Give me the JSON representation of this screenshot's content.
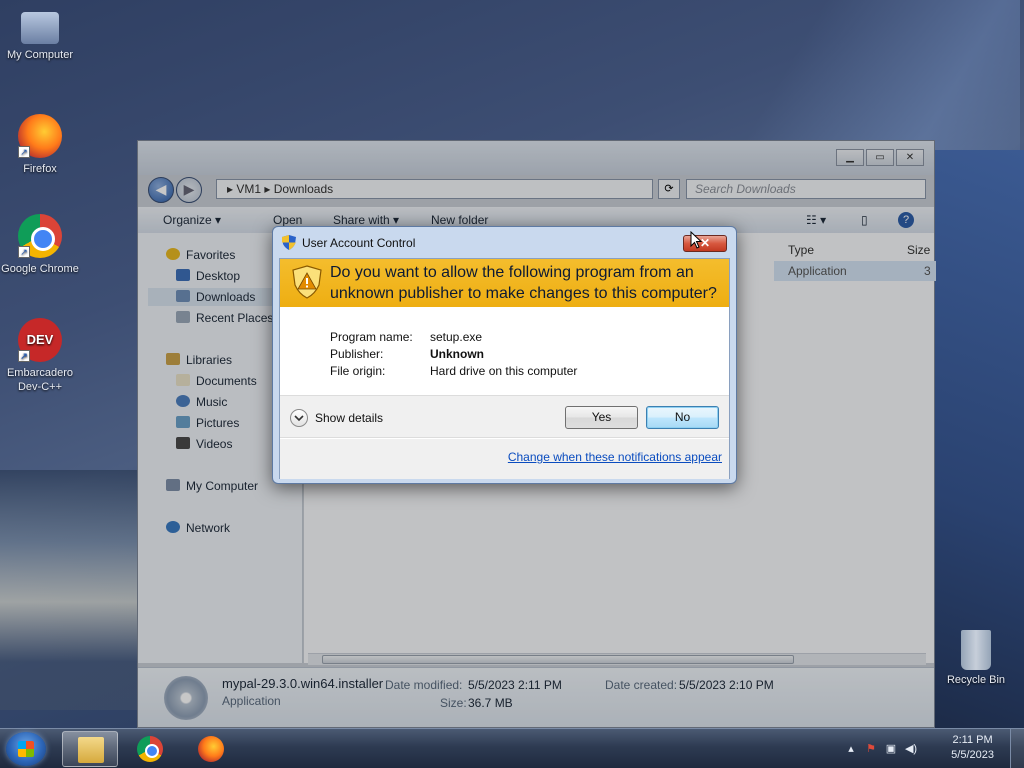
{
  "desktop": {
    "icons": [
      {
        "label": "My Computer"
      },
      {
        "label": "Firefox"
      },
      {
        "label": "Google Chrome"
      },
      {
        "label": "Embarcadero Dev-C++",
        "glyph_text": "DEV"
      }
    ],
    "recycle_bin": {
      "label": "Recycle Bin"
    }
  },
  "explorer": {
    "path": [
      "VM1",
      "Downloads"
    ],
    "search_placeholder": "Search Downloads",
    "toolbar": {
      "organize": "Organize ▾",
      "open": "Open",
      "share_with": "Share with ▾",
      "new_folder": "New folder"
    },
    "columns": {
      "type": "Type",
      "size": "Size"
    },
    "file_type_cell": "Application",
    "file_size_cell": "3",
    "nav": {
      "favorites": "Favorites",
      "desktop": "Desktop",
      "downloads": "Downloads",
      "recent_places": "Recent Places",
      "libraries": "Libraries",
      "documents": "Documents",
      "music": "Music",
      "pictures": "Pictures",
      "videos": "Videos",
      "my_computer": "My Computer",
      "network": "Network"
    },
    "details": {
      "file_name": "mypal-29.3.0.win64.installer",
      "file_type": "Application",
      "date_modified_label": "Date modified:",
      "date_modified": "5/5/2023 2:11 PM",
      "date_created_label": "Date created:",
      "date_created": "5/5/2023 2:10 PM",
      "size_label": "Size:",
      "size": "36.7 MB"
    }
  },
  "uac": {
    "title": "User Account Control",
    "close_symbol": "✕",
    "question": "Do you want to allow the following program from an unknown publisher to make changes to this computer?",
    "fields": [
      {
        "key": "Program name:",
        "value": "setup.exe",
        "bold": false
      },
      {
        "key": "Publisher:",
        "value": "Unknown",
        "bold": true
      },
      {
        "key": "File origin:",
        "value": "Hard drive on this computer",
        "bold": false
      }
    ],
    "show_details": "Show details",
    "yes_label": "Yes",
    "no_label": "No",
    "change_link": "Change when these notifications appear",
    "colors": {
      "banner": "#f0b31a",
      "link": "#0a4cbf"
    }
  },
  "taskbar": {
    "clock_time": "2:11 PM",
    "clock_date": "5/5/2023",
    "pinned": [
      "windows-explorer-icon",
      "chrome-icon",
      "firefox-icon"
    ]
  }
}
